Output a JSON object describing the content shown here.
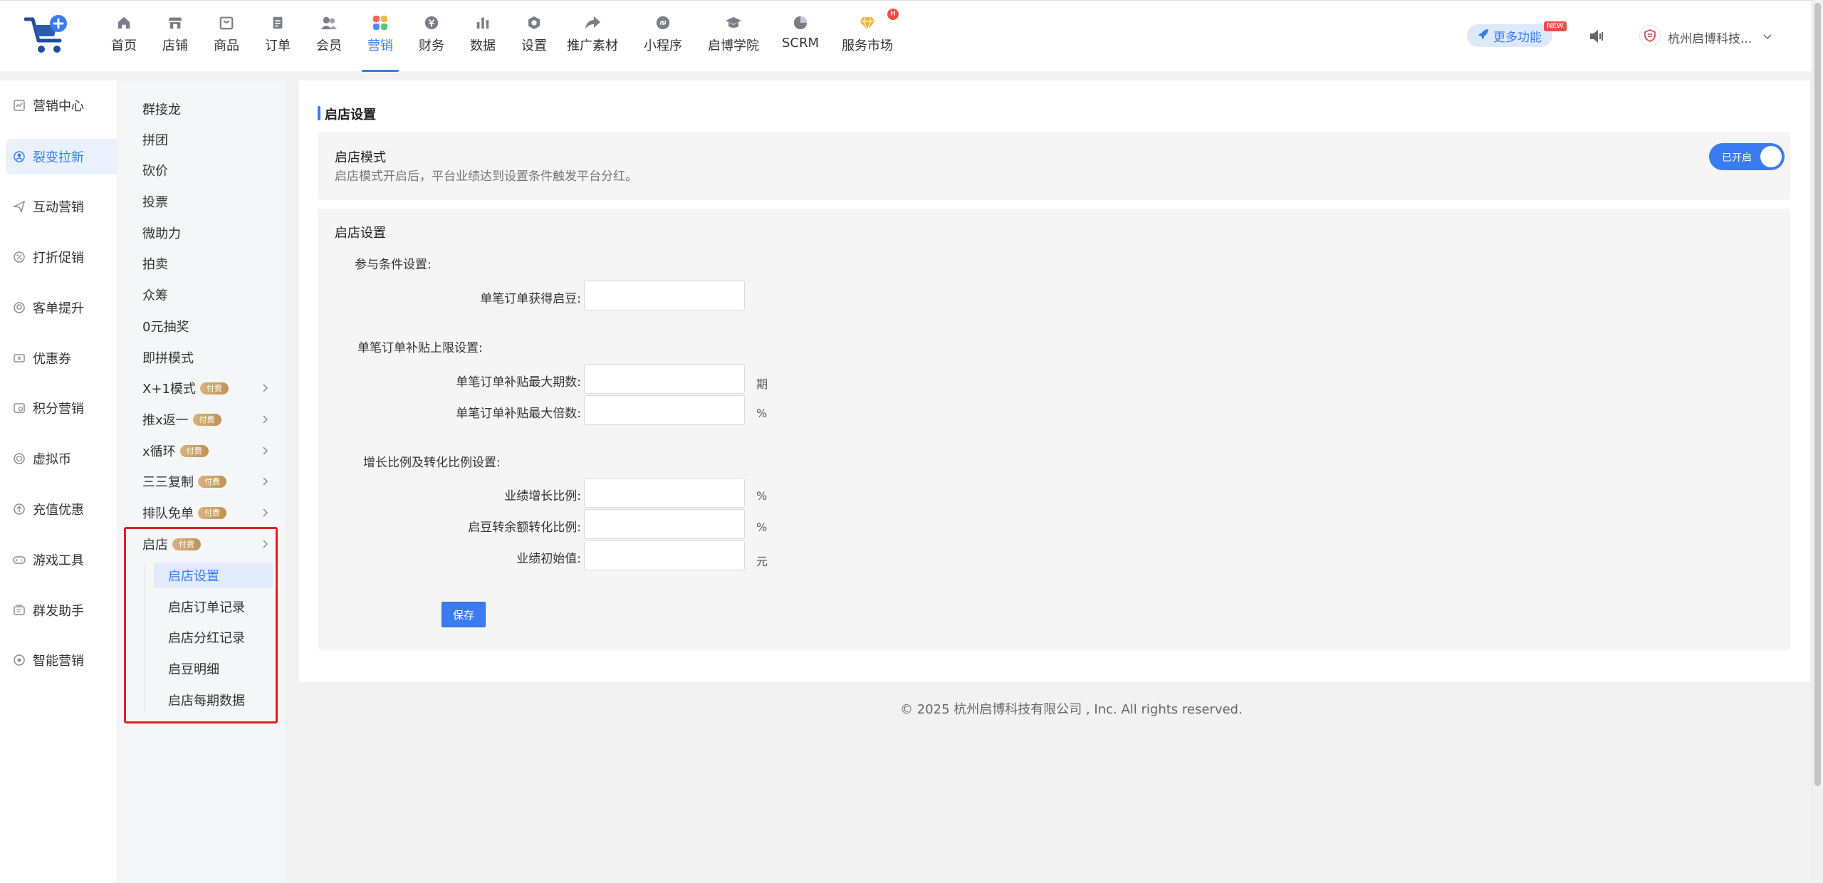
{
  "nav": {
    "items": [
      {
        "label": "首页",
        "icon": "home-icon"
      },
      {
        "label": "店铺",
        "icon": "store-icon"
      },
      {
        "label": "商品",
        "icon": "goods-icon"
      },
      {
        "label": "订单",
        "icon": "order-icon"
      },
      {
        "label": "会员",
        "icon": "member-icon"
      },
      {
        "label": "营销",
        "icon": "marketing-icon",
        "active": true
      },
      {
        "label": "财务",
        "icon": "finance-icon"
      },
      {
        "label": "数据",
        "icon": "data-icon"
      },
      {
        "label": "设置",
        "icon": "settings-icon"
      },
      {
        "label": "推广素材",
        "icon": "share-icon"
      },
      {
        "label": "小程序",
        "icon": "miniprogram-icon"
      },
      {
        "label": "启博学院",
        "icon": "academy-icon"
      },
      {
        "label": "SCRM",
        "icon": "scrm-icon"
      },
      {
        "label": "服务市场",
        "icon": "market-icon",
        "badge": "H"
      }
    ],
    "more_label": "更多功能",
    "new_tag": "NEW",
    "company": "杭州启博科技..."
  },
  "sidebar": {
    "items": [
      {
        "label": "营销中心",
        "icon": "chart-icon"
      },
      {
        "label": "裂变拉新",
        "icon": "fission-icon",
        "active": true
      },
      {
        "label": "互动营销",
        "icon": "send-icon"
      },
      {
        "label": "打折促销",
        "icon": "discount-icon"
      },
      {
        "label": "客单提升",
        "icon": "upgrade-icon"
      },
      {
        "label": "优惠券",
        "icon": "coupon-icon"
      },
      {
        "label": "积分营销",
        "icon": "points-icon"
      },
      {
        "label": "虚拟币",
        "icon": "coin-icon"
      },
      {
        "label": "充值优惠",
        "icon": "recharge-icon"
      },
      {
        "label": "游戏工具",
        "icon": "game-icon"
      },
      {
        "label": "群发助手",
        "icon": "broadcast-icon"
      },
      {
        "label": "智能营销",
        "icon": "smart-icon"
      }
    ]
  },
  "submenu": {
    "items": [
      {
        "label": "群接龙"
      },
      {
        "label": "拼团"
      },
      {
        "label": "砍价"
      },
      {
        "label": "投票"
      },
      {
        "label": "微助力"
      },
      {
        "label": "拍卖"
      },
      {
        "label": "众筹"
      },
      {
        "label": "0元抽奖"
      },
      {
        "label": "即拼模式"
      },
      {
        "label": "X+1模式",
        "paid": "付费"
      },
      {
        "label": "推x返一",
        "paid": "付费"
      },
      {
        "label": "x循环",
        "paid": "付费"
      },
      {
        "label": "三三复制",
        "paid": "付费"
      },
      {
        "label": "排队免单",
        "paid": "付费"
      },
      {
        "label": "启店",
        "paid": "付费"
      }
    ],
    "children": [
      {
        "label": "启店设置",
        "active": true
      },
      {
        "label": "启店订单记录"
      },
      {
        "label": "启店分红记录"
      },
      {
        "label": "启豆明细"
      },
      {
        "label": "启店每期数据"
      }
    ]
  },
  "main": {
    "title": "启店设置",
    "mode": {
      "title": "启店模式",
      "desc": "启店模式开启后，平台业绩达到设置条件触发平台分红。",
      "toggle_label": "已开启",
      "enabled": true
    },
    "settings": {
      "title": "启店设置",
      "group1": "参与条件设置:",
      "field_bean": "单笔订单获得启豆:",
      "group2": "单笔订单补贴上限设置:",
      "field_max_periods": "单笔订单补贴最大期数:",
      "unit_periods": "期",
      "field_max_multiple": "单笔订单补贴最大倍数:",
      "unit_percent": "%",
      "group3": "增长比例及转化比例设置:",
      "field_growth": "业绩增长比例:",
      "field_convert": "启豆转余额转化比例:",
      "field_initial": "业绩初始值:",
      "unit_yuan": "元",
      "values": {
        "bean": "",
        "max_periods": "",
        "max_multiple": "",
        "growth": "",
        "convert": "",
        "initial": ""
      },
      "save_label": "保存"
    }
  },
  "footer": "© 2025 杭州启博科技有限公司 , Inc. All rights reserved.",
  "colors": {
    "accent": "#3b7bf0",
    "paid_badge": "#c99b5e",
    "highlight_box": "#e21f1f"
  }
}
